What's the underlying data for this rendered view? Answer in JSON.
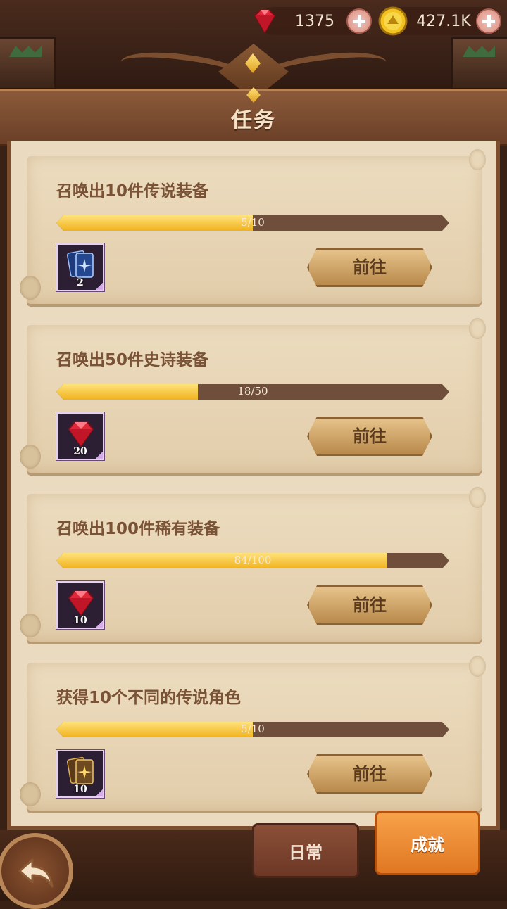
{
  "currency": {
    "gems": {
      "value": "1375",
      "icon": "ruby-gem-icon"
    },
    "gold": {
      "value": "427.1K",
      "icon": "gold-coin-icon"
    }
  },
  "header": {
    "title": "任务"
  },
  "tasks": [
    {
      "title": "召唤出10件传说装备",
      "progress": 5,
      "total": 10,
      "progress_text": "5/10",
      "reward": {
        "icon": "blue-card-icon",
        "count": "2"
      },
      "button": "前往"
    },
    {
      "title": "召唤出50件史诗装备",
      "progress": 18,
      "total": 50,
      "progress_text": "18/50",
      "reward": {
        "icon": "ruby-gem-icon",
        "count": "20"
      },
      "button": "前往"
    },
    {
      "title": "召唤出100件稀有装备",
      "progress": 84,
      "total": 100,
      "progress_text": "84/100",
      "reward": {
        "icon": "ruby-gem-icon",
        "count": "10"
      },
      "button": "前往"
    },
    {
      "title": "获得10个不同的传说角色",
      "progress": 5,
      "total": 10,
      "progress_text": "5/10",
      "reward": {
        "icon": "gold-card-icon",
        "count": "10"
      },
      "button": "前往"
    }
  ],
  "tabs": {
    "daily": "日常",
    "achievements": "成就",
    "active": "achievements"
  },
  "colors": {
    "progress_fill": "#f0b21e",
    "active_tab": "#e07722",
    "inactive_tab": "#6c3826"
  }
}
